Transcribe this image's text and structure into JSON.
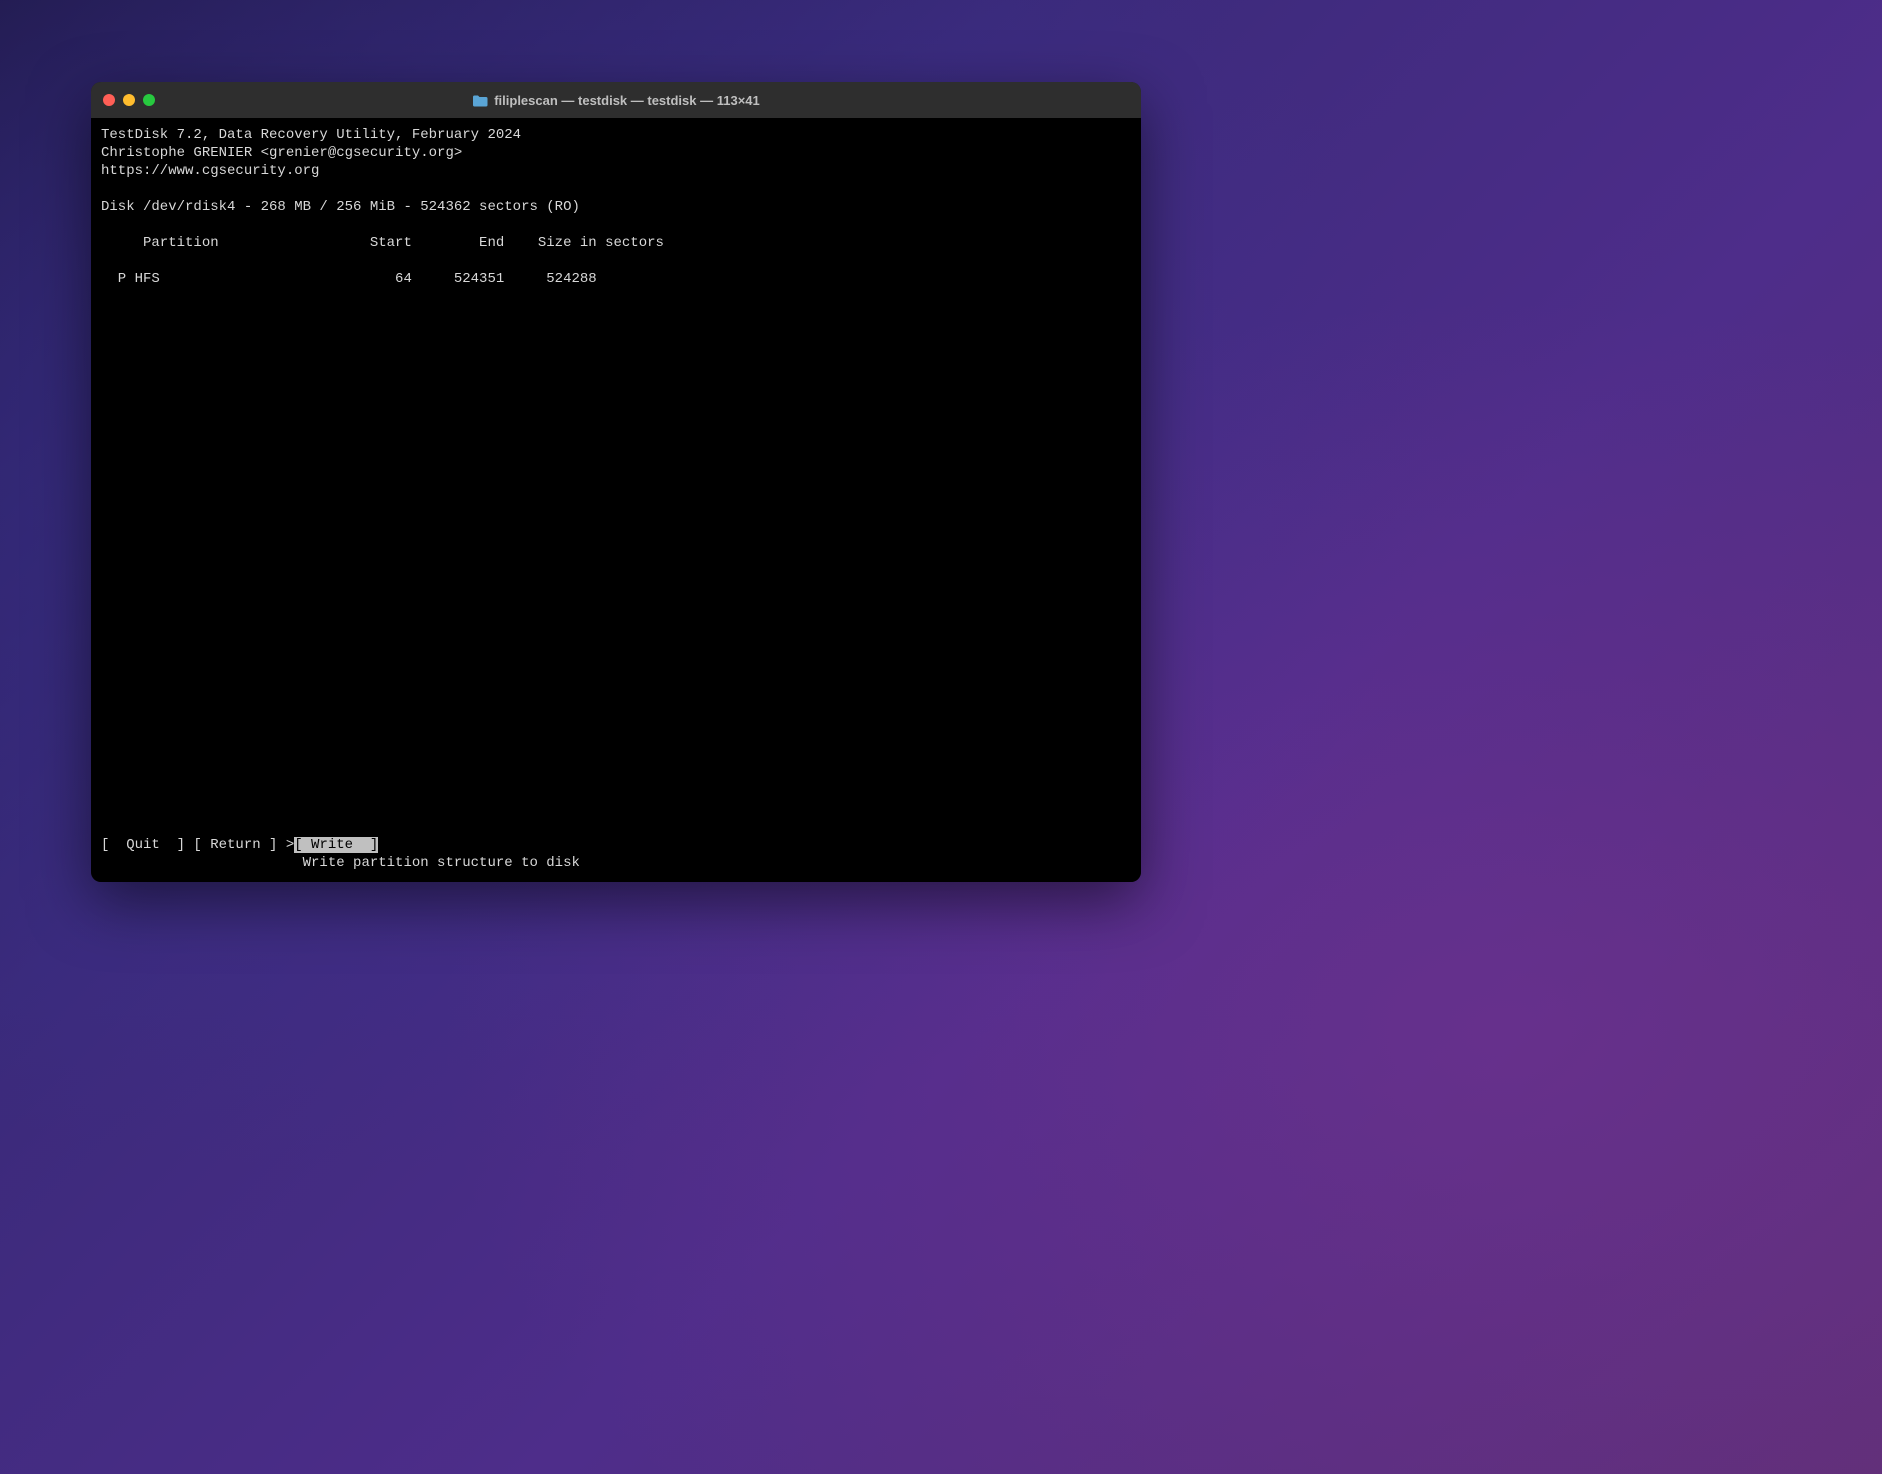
{
  "window": {
    "title": "filiplescan — testdisk — testdisk — 113×41"
  },
  "header": {
    "line1": "TestDisk 7.2, Data Recovery Utility, February 2024",
    "line2": "Christophe GRENIER <grenier@cgsecurity.org>",
    "line3": "https://www.cgsecurity.org"
  },
  "disk": {
    "info": "Disk /dev/rdisk4 - 268 MB / 256 MiB - 524362 sectors (RO)"
  },
  "table": {
    "header": "     Partition                  Start        End    Size in sectors",
    "row1": "  P HFS                            64     524351     524288"
  },
  "menu": {
    "quit": "[  Quit  ] ",
    "return": "[ Return ] ",
    "marker": ">",
    "write": "[ Write  ]",
    "help": "                        Write partition structure to disk"
  }
}
